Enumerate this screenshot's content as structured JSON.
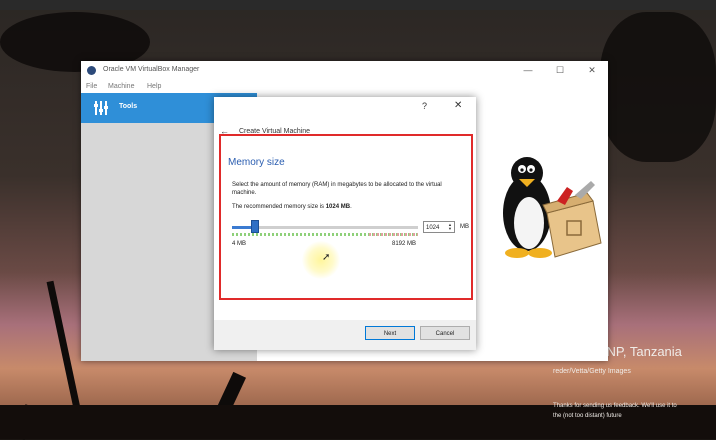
{
  "wallpaper": {
    "location_caption": "i NP, Tanzania",
    "credit": "reder/Vetta/Getty Images",
    "feedback_line1": "Thanks for sending us feedback. We'll use it to",
    "feedback_line2": "the (not too distant) future"
  },
  "vbox": {
    "title": "Oracle VM VirtualBox Manager",
    "menu": [
      "File",
      "Machine",
      "Help"
    ],
    "tools_label": "Tools",
    "window_controls": {
      "minimize": "—",
      "maximize": "☐",
      "close": "✕"
    }
  },
  "dialog": {
    "help": "?",
    "close": "✕",
    "back": "←",
    "heading": "Create Virtual Machine",
    "section_title": "Memory size",
    "description": "Select the amount of memory (RAM) in megabytes to be allocated to the virtual machine.",
    "recommend_prefix": "The recommended memory size is ",
    "recommend_value": "1024 MB",
    "recommend_suffix": ".",
    "memory_value": "1024",
    "memory_unit": "MB",
    "slider_min_label": "4 MB",
    "slider_max_label": "8192 MB",
    "slider_fraction": 0.125,
    "buttons": {
      "next": "Next",
      "cancel": "Cancel"
    }
  },
  "colors": {
    "accent": "#2f8fd8",
    "highlight_border": "#e02a2a",
    "section_title": "#2a5db0"
  }
}
